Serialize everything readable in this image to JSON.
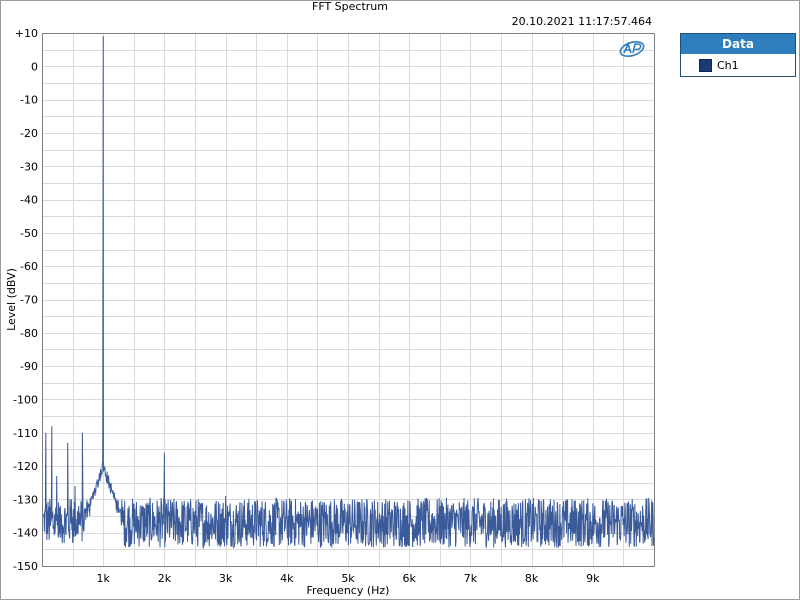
{
  "timestamp": "20.10.2021 11:17:57.464",
  "legend": {
    "title": "Data",
    "items": [
      {
        "label": "Ch1",
        "color": "#1b3b78"
      }
    ]
  },
  "chart_data": {
    "type": "line",
    "title": "FFT Spectrum",
    "xlabel": "Frequency (Hz)",
    "ylabel": "Level (dBV)",
    "xlim": [
      0,
      10000
    ],
    "ylim": [
      -150,
      10
    ],
    "x_scale": "linear",
    "grid": true,
    "legend_position": "right",
    "x_ticks": [
      {
        "value": 1000,
        "label": "1k"
      },
      {
        "value": 2000,
        "label": "2k"
      },
      {
        "value": 3000,
        "label": "3k"
      },
      {
        "value": 4000,
        "label": "4k"
      },
      {
        "value": 5000,
        "label": "5k"
      },
      {
        "value": 6000,
        "label": "6k"
      },
      {
        "value": 7000,
        "label": "7k"
      },
      {
        "value": 8000,
        "label": "8k"
      },
      {
        "value": 9000,
        "label": "9k"
      }
    ],
    "y_ticks": [
      {
        "value": 10,
        "label": "+10"
      },
      {
        "value": 0,
        "label": "0"
      },
      {
        "value": -10,
        "label": "-10"
      },
      {
        "value": -20,
        "label": "-20"
      },
      {
        "value": -30,
        "label": "-30"
      },
      {
        "value": -40,
        "label": "-40"
      },
      {
        "value": -50,
        "label": "-50"
      },
      {
        "value": -60,
        "label": "-60"
      },
      {
        "value": -70,
        "label": "-70"
      },
      {
        "value": -80,
        "label": "-80"
      },
      {
        "value": -90,
        "label": "-90"
      },
      {
        "value": -100,
        "label": "-100"
      },
      {
        "value": -110,
        "label": "-110"
      },
      {
        "value": -120,
        "label": "-120"
      },
      {
        "value": -130,
        "label": "-130"
      },
      {
        "value": -140,
        "label": "-140"
      },
      {
        "value": -150,
        "label": "-150"
      }
    ],
    "series": [
      {
        "name": "Ch1",
        "color": "#3a5a9a",
        "noise_floor_dbv": -137,
        "noise_floor_range_dbv": [
          -147,
          -127
        ],
        "peaks": [
          {
            "x": 1000,
            "y": 9
          },
          {
            "x": 62,
            "y": -110
          },
          {
            "x": 160,
            "y": -108
          },
          {
            "x": 240,
            "y": -123
          },
          {
            "x": 300,
            "y": -132
          },
          {
            "x": 420,
            "y": -113
          },
          {
            "x": 480,
            "y": -130
          },
          {
            "x": 540,
            "y": -126
          },
          {
            "x": 600,
            "y": -132
          },
          {
            "x": 660,
            "y": -110
          },
          {
            "x": 720,
            "y": -133
          },
          {
            "x": 780,
            "y": -135
          },
          {
            "x": 2000,
            "y": -116
          },
          {
            "x": 3000,
            "y": -129
          }
        ],
        "skirt_around_1k": {
          "x_range": [
            800,
            1300
          ],
          "level_dbv": -120
        }
      }
    ]
  }
}
